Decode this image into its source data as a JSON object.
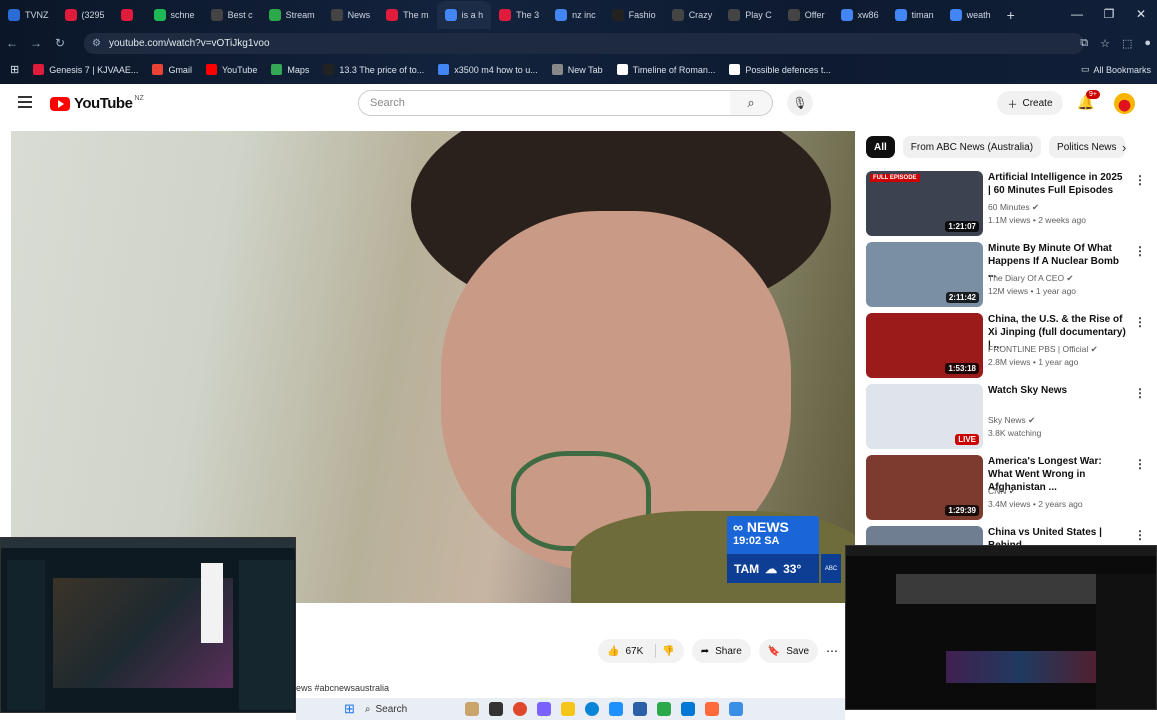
{
  "browser": {
    "tabs": [
      {
        "label": "TVNZ",
        "color": "#2b6bd6"
      },
      {
        "label": "(3295",
        "color": "#e01b3c"
      },
      {
        "label": "",
        "color": "#e01b3c"
      },
      {
        "label": "schne",
        "color": "#1db954"
      },
      {
        "label": "Best c",
        "color": "#444"
      },
      {
        "label": "Stream",
        "color": "#2ba84a"
      },
      {
        "label": "News",
        "color": "#444"
      },
      {
        "label": "The m",
        "color": "#e01b3c"
      },
      {
        "label": "is a h",
        "color": "#4285f4"
      },
      {
        "label": "The 3",
        "color": "#e01b3c"
      },
      {
        "label": "nz inc",
        "color": "#4285f4"
      },
      {
        "label": "Fashio",
        "color": "#222"
      },
      {
        "label": "Crazy",
        "color": "#444"
      },
      {
        "label": "Play C",
        "color": "#444"
      },
      {
        "label": "Offer",
        "color": "#444"
      },
      {
        "label": "xw86",
        "color": "#4285f4"
      },
      {
        "label": "timan",
        "color": "#4285f4"
      },
      {
        "label": "weath",
        "color": "#4285f4"
      }
    ],
    "url": "youtube.com/watch?v=vOTiJkg1voo",
    "bookmarks": [
      {
        "label": "Genesis 7 | KJVAAE...",
        "color": "#e01b3c"
      },
      {
        "label": "Gmail",
        "color": "#ea4335"
      },
      {
        "label": "YouTube",
        "color": "#ff0000"
      },
      {
        "label": "Maps",
        "color": "#34a853"
      },
      {
        "label": "13.3 The price of to...",
        "color": "#222"
      },
      {
        "label": "x3500 m4 how to u...",
        "color": "#4285f4"
      },
      {
        "label": "New Tab",
        "color": "#888"
      },
      {
        "label": "Timeline of Roman...",
        "color": "#fff"
      },
      {
        "label": "Possible defences t...",
        "color": "#fff"
      }
    ],
    "all_bookmarks": "All Bookmarks"
  },
  "youtube": {
    "region": "NZ",
    "logo_text": "YouTube",
    "search_placeholder": "Search",
    "create_label": "Create",
    "notif_badge": "9+"
  },
  "overlay": {
    "brand": "NEWS",
    "time": "19:02",
    "tz": "SA",
    "city": "TAM",
    "temp": "33°"
  },
  "actions": {
    "likes": "67K",
    "share": "Share",
    "save": "Save"
  },
  "hashtags": "ews #abcnewsaustralia",
  "chips": [
    "All",
    "From ABC News (Australia)",
    "Politics News"
  ],
  "recommendations": [
    {
      "title": "Artificial Intelligence in 2025 | 60 Minutes Full Episodes",
      "channel": "60 Minutes",
      "meta": "1.1M views • 2 weeks ago",
      "duration": "1:21:07",
      "caption": "FULL EPISODE",
      "thumb": "#3d4250"
    },
    {
      "title": "Minute By Minute Of What Happens If A Nuclear Bomb ...",
      "channel": "The Diary Of A CEO",
      "meta": "12M views • 1 year ago",
      "duration": "2:11:42",
      "caption": "",
      "thumb": "#7a8fa3"
    },
    {
      "title": "China, the U.S. & the Rise of Xi Jinping (full documentary) | ...",
      "channel": "FRONTLINE PBS | Official",
      "meta": "2.8M views • 1 year ago",
      "duration": "1:53:18",
      "caption": "",
      "thumb": "#9b1b1b"
    },
    {
      "title": "Watch Sky News",
      "channel": "Sky News",
      "meta": "3.8K watching",
      "duration": "LIVE",
      "caption": "",
      "thumb": "#dfe3ea"
    },
    {
      "title": "America's Longest War: What Went Wrong in Afghanistan ...",
      "channel": "CNN",
      "meta": "3.4M views • 2 years ago",
      "duration": "1:29:39",
      "caption": "",
      "thumb": "#7d3a2e"
    },
    {
      "title": "China vs United States | Behind",
      "channel": "",
      "meta": "",
      "duration": "",
      "caption": "",
      "thumb": "#6f7f91"
    }
  ],
  "taskbar": {
    "search": "Search"
  }
}
